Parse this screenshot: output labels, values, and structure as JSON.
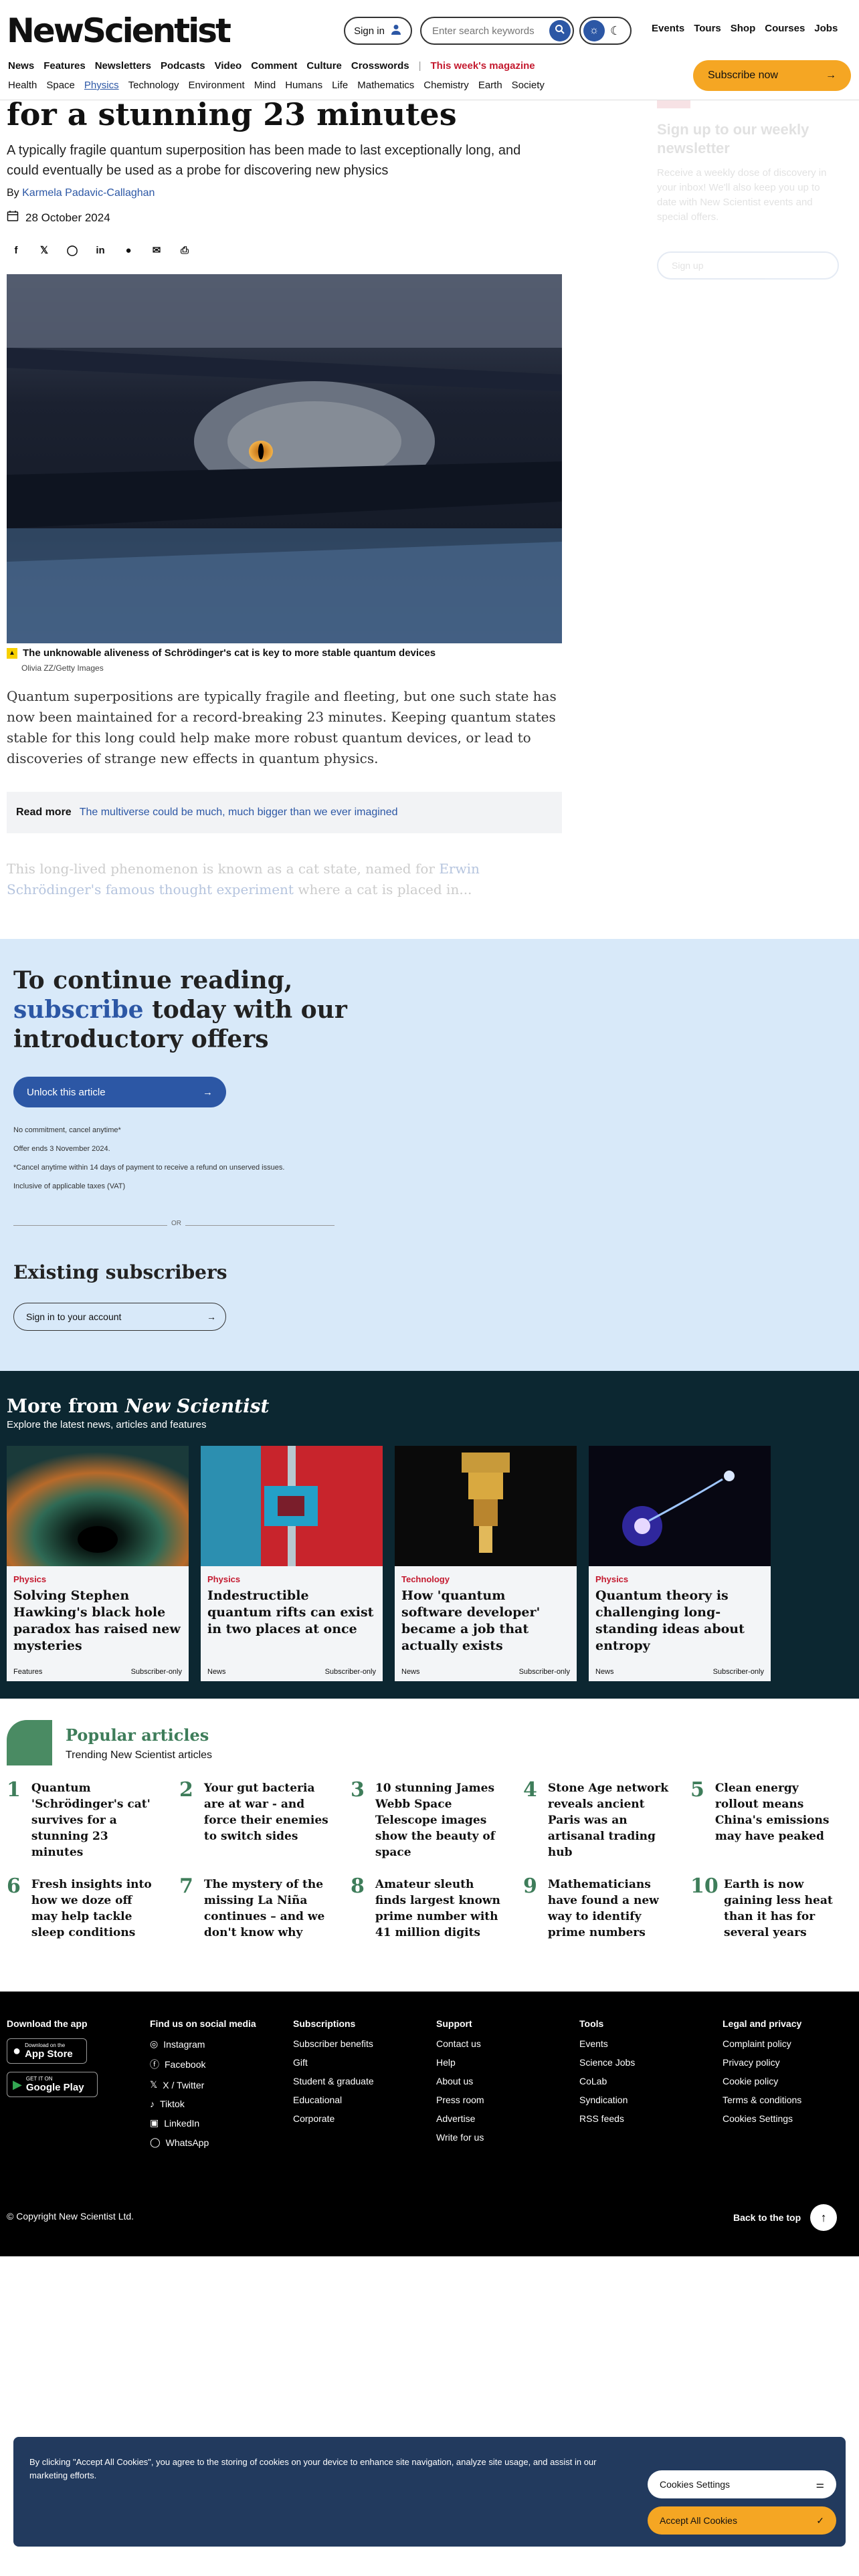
{
  "header": {
    "logo": "NewScientist",
    "sign_in": "Sign in",
    "search_placeholder": "Enter search keywords",
    "top_links": [
      "Events",
      "Tours",
      "Shop",
      "Courses",
      "Jobs"
    ],
    "primary_nav": [
      "News",
      "Features",
      "Newsletters",
      "Podcasts",
      "Video",
      "Comment",
      "Culture",
      "Crosswords"
    ],
    "magazine_link": "This week's magazine",
    "secondary_nav": [
      "Health",
      "Space",
      "Physics",
      "Technology",
      "Environment",
      "Mind",
      "Humans",
      "Life",
      "Mathematics",
      "Chemistry",
      "Earth",
      "Society"
    ],
    "active_section": "Physics",
    "subscribe": "Subscribe now"
  },
  "article": {
    "headline": "for a stunning 23 minutes",
    "standfirst": "A typically fragile quantum superposition has been made to last exceptionally long, and could eventually be used as a probe for discovering new physics",
    "by": "By",
    "author": "Karmela Padavic-Callaghan",
    "date": "28 October 2024",
    "caption": "The unknowable aliveness of Schrödinger's cat is key to more stable quantum devices",
    "credit": "Olivia ZZ/Getty Images",
    "paragraph1": "Quantum superpositions are typically fragile and fleeting, but one such state has now been maintained for a record-breaking 23 minutes. Keeping quantum states stable for this long could help make more robust quantum devices, or lead to discoveries of strange new effects in quantum physics.",
    "read_more_label": "Read more",
    "read_more_link": "The multiverse could be much, much bigger than we ever imagined",
    "paragraph2_start": "This long-lived phenomenon is known as a cat state, named for ",
    "paragraph2_link": "Erwin Schrödinger's famous thought experiment",
    "paragraph2_end": " where a cat is placed in..."
  },
  "sidebar": {
    "title": "Sign up to our weekly newsletter",
    "body": "Receive a weekly dose of discovery in your inbox! We'll also keep you up to date with New Scientist events and special offers.",
    "button": "Sign up"
  },
  "paywall": {
    "line1": "To continue reading,",
    "line2_blue": "subscribe",
    "line2_rest": " today with our",
    "line3": "introductory offers",
    "unlock": "Unlock this article",
    "note1": "No commitment, cancel anytime*",
    "note2": "Offer ends 3 November 2024.",
    "note3": "*Cancel anytime within 14 days of payment to receive a refund on unserved issues.",
    "note4": "Inclusive of applicable taxes (VAT)",
    "or": "OR",
    "existing": "Existing subscribers",
    "signin_account": "Sign in to your account"
  },
  "more": {
    "title_pre": "More from ",
    "title_brand": "New Scientist",
    "subtitle": "Explore the latest news, articles and features",
    "cards": [
      {
        "category": "Physics",
        "title": "Solving Stephen Hawking's black hole paradox has raised new mysteries",
        "type": "Features",
        "access": "Subscriber-only"
      },
      {
        "category": "Physics",
        "title": "Indestructible quantum rifts can exist in two places at once",
        "type": "News",
        "access": "Subscriber-only"
      },
      {
        "category": "Technology",
        "title": "How 'quantum software developer' became a job that actually exists",
        "type": "News",
        "access": "Subscriber-only"
      },
      {
        "category": "Physics",
        "title": "Quantum theory is challenging long-standing ideas about entropy",
        "type": "News",
        "access": "Subscriber-only"
      }
    ]
  },
  "popular": {
    "title": "Popular articles",
    "subtitle": "Trending New Scientist articles",
    "items": [
      {
        "num": "1",
        "title": "Quantum 'Schrödinger's cat' survives for a stunning 23 minutes"
      },
      {
        "num": "2",
        "title": "Your gut bacteria are at war - and force their enemies to switch sides"
      },
      {
        "num": "3",
        "title": "10 stunning James Webb Space Telescope images show the beauty of space"
      },
      {
        "num": "4",
        "title": "Stone Age network reveals ancient Paris was an artisanal trading hub"
      },
      {
        "num": "5",
        "title": "Clean energy rollout means China's emissions may have peaked"
      },
      {
        "num": "6",
        "title": "Fresh insights into how we doze off may help tackle sleep conditions"
      },
      {
        "num": "7",
        "title": "The mystery of the missing La Niña continues – and we don't know why"
      },
      {
        "num": "8",
        "title": "Amateur sleuth finds largest known prime number with 41 million digits"
      },
      {
        "num": "9",
        "title": "Mathematicians have found a new way to identify prime numbers"
      },
      {
        "num": "10",
        "title": "Earth is now gaining less heat than it has for several years"
      }
    ]
  },
  "footer": {
    "app_title": "Download the app",
    "app_store_small": "Download on the",
    "app_store_big": "App Store",
    "play_small": "GET IT ON",
    "play_big": "Google Play",
    "social_title": "Find us on social media",
    "social": [
      "Instagram",
      "Facebook",
      "X / Twitter",
      "Tiktok",
      "LinkedIn",
      "WhatsApp"
    ],
    "subs_title": "Subscriptions",
    "subs": [
      "Subscriber benefits",
      "Gift",
      "Student & graduate",
      "Educational",
      "Corporate"
    ],
    "support_title": "Support",
    "support": [
      "Contact us",
      "Help",
      "About us",
      "Press room",
      "Advertise",
      "Write for us"
    ],
    "tools_title": "Tools",
    "tools": [
      "Events",
      "Science Jobs",
      "CoLab",
      "Syndication",
      "RSS feeds"
    ],
    "legal_title": "Legal and privacy",
    "legal": [
      "Complaint policy",
      "Privacy policy",
      "Cookie policy",
      "Terms & conditions",
      "Cookies Settings"
    ],
    "copyright": "© Copyright New Scientist Ltd.",
    "back_top": "Back to the top"
  },
  "cookie": {
    "text": "By clicking \"Accept All Cookies\", you agree to the storing of cookies on your device to enhance site navigation, analyze site usage, and assist in our marketing efforts.",
    "settings": "Cookies Settings",
    "accept": "Accept All Cookies"
  },
  "colors": {
    "brand_blue": "#2c57a5",
    "accent_orange": "#f5a623",
    "brand_green": "#3e7d5a",
    "paywall_bg": "#d8e9f9",
    "dark_teal": "#0c2731"
  }
}
